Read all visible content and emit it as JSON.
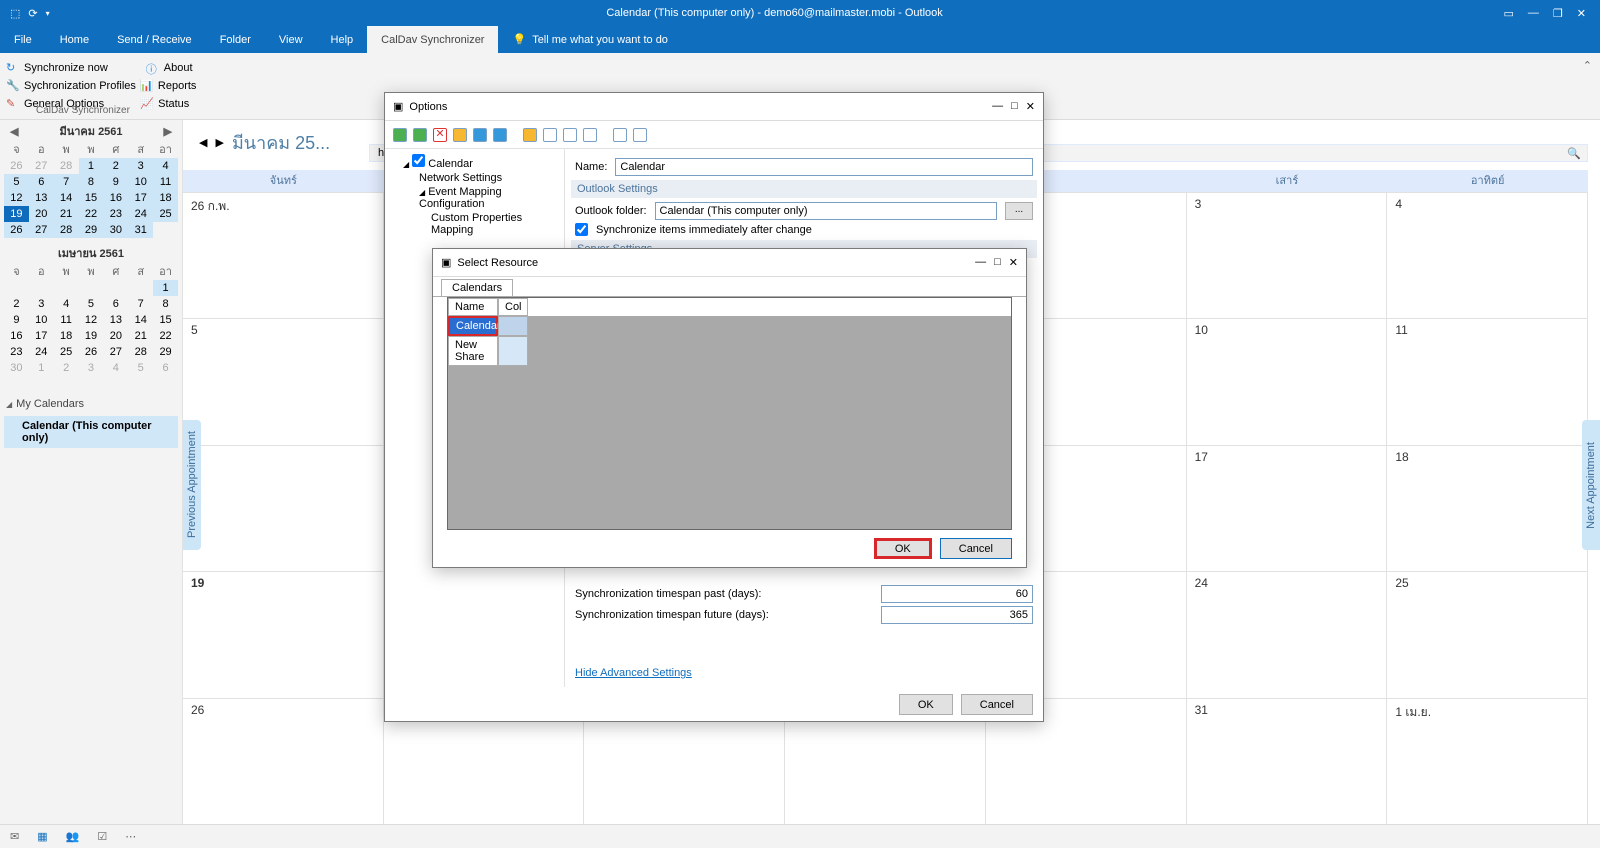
{
  "title": "Calendar (This computer only) - demo60@mailmaster.mobi - Outlook",
  "menus": {
    "file": "File",
    "home": "Home",
    "sendrecv": "Send / Receive",
    "folder": "Folder",
    "view": "View",
    "help": "Help",
    "caldav": "CalDav Synchronizer",
    "tell": "Tell me what you want to do"
  },
  "ribbon": {
    "sync_now": "Synchronize now",
    "about": "About",
    "profiles": "Sychronization Profiles",
    "reports": "Reports",
    "general": "General Options",
    "status": "Status",
    "group": "CalDav Synchronizer"
  },
  "minimonth1": {
    "title": "มีนาคม 2561",
    "days": [
      "จ",
      "อ",
      "พ",
      "พ",
      "ศ",
      "ส",
      "อา"
    ],
    "cells": [
      [
        26,
        "dim"
      ],
      [
        27,
        "dim"
      ],
      [
        28,
        "dim"
      ],
      [
        1,
        "sel"
      ],
      [
        2,
        "sel"
      ],
      [
        3,
        "sel"
      ],
      [
        4,
        "sel"
      ],
      [
        5,
        "sel"
      ],
      [
        6,
        "sel"
      ],
      [
        7,
        "sel"
      ],
      [
        8,
        "sel"
      ],
      [
        9,
        "sel"
      ],
      [
        10,
        "sel"
      ],
      [
        11,
        "sel"
      ],
      [
        12,
        "sel"
      ],
      [
        13,
        "sel"
      ],
      [
        14,
        "sel"
      ],
      [
        15,
        "sel"
      ],
      [
        16,
        "sel"
      ],
      [
        17,
        "sel"
      ],
      [
        18,
        "sel"
      ],
      [
        19,
        "today"
      ],
      [
        20,
        "sel"
      ],
      [
        21,
        "sel"
      ],
      [
        22,
        "sel"
      ],
      [
        23,
        "sel"
      ],
      [
        24,
        "sel"
      ],
      [
        25,
        "sel"
      ],
      [
        26,
        "sel"
      ],
      [
        27,
        "sel"
      ],
      [
        28,
        "sel"
      ],
      [
        29,
        "sel"
      ],
      [
        30,
        "sel"
      ],
      [
        31,
        "sel"
      ]
    ]
  },
  "minimonth2": {
    "title": "เมษายน 2561",
    "cells": [
      [
        "",
        "",
        ""
      ],
      [
        "",
        "",
        ""
      ],
      [
        "",
        "",
        ""
      ],
      [
        "",
        "",
        ""
      ],
      [
        "",
        "",
        ""
      ],
      [
        "",
        "",
        ""
      ],
      [
        1,
        "sel"
      ],
      [
        2,
        ""
      ],
      [
        3,
        ""
      ],
      [
        4,
        ""
      ],
      [
        5,
        ""
      ],
      [
        6,
        ""
      ],
      [
        7,
        ""
      ],
      [
        8,
        ""
      ],
      [
        9,
        ""
      ],
      [
        10,
        ""
      ],
      [
        11,
        ""
      ],
      [
        12,
        ""
      ],
      [
        13,
        ""
      ],
      [
        14,
        ""
      ],
      [
        15,
        ""
      ],
      [
        16,
        ""
      ],
      [
        17,
        ""
      ],
      [
        18,
        ""
      ],
      [
        19,
        ""
      ],
      [
        20,
        ""
      ],
      [
        21,
        ""
      ],
      [
        22,
        ""
      ],
      [
        23,
        ""
      ],
      [
        24,
        ""
      ],
      [
        25,
        ""
      ],
      [
        26,
        ""
      ],
      [
        27,
        ""
      ],
      [
        28,
        ""
      ],
      [
        29,
        ""
      ],
      [
        30,
        "dim"
      ],
      [
        1,
        "dim"
      ],
      [
        2,
        "dim"
      ],
      [
        3,
        "dim"
      ],
      [
        4,
        "dim"
      ],
      [
        5,
        "dim"
      ],
      [
        6,
        "dim"
      ]
    ]
  },
  "mycal": {
    "header": "My Calendars",
    "item": "Calendar (This computer only)"
  },
  "calheader": {
    "month": "มีนาคม 25...",
    "subtitle": "his computer only)"
  },
  "dayheads": [
    "จันทร์",
    "",
    "",
    "",
    "",
    "เสาร์",
    "อาทิตย์"
  ],
  "grid": [
    [
      "26 ก.พ.",
      "",
      "",
      "",
      "",
      "3",
      "4"
    ],
    [
      "5",
      "",
      "",
      "",
      "",
      "10",
      "11"
    ],
    [
      "",
      "",
      "",
      "",
      "",
      "17",
      "18"
    ],
    [
      "19",
      "",
      "",
      "",
      "",
      "24",
      "25"
    ],
    [
      "26",
      "",
      "",
      "",
      "",
      "31",
      "1 เม.ย."
    ]
  ],
  "prev_appt": "Previous Appointment",
  "next_appt": "Next Appointment",
  "options": {
    "title": "Options",
    "tree": {
      "root": "Calendar",
      "t1": "Network Settings",
      "t2": "Event Mapping Configuration",
      "t3": "Custom Properties Mapping"
    },
    "name_l": "Name:",
    "name_v": "Calendar",
    "out_sec": "Outlook Settings",
    "out_folder_l": "Outlook folder:",
    "out_folder_v": "Calendar (This computer only)",
    "sync_chk": "Synchronize items immediately after change",
    "srv_sec": "Server Settings",
    "past_l": "Synchronization timespan past (days):",
    "past_v": "60",
    "fut_l": "Synchronization timespan future (days):",
    "fut_v": "365",
    "hide": "Hide Advanced Settings",
    "ok": "OK",
    "cancel": "Cancel"
  },
  "resource": {
    "title": "Select Resource",
    "tab": "Calendars",
    "h1": "Name",
    "h2": "Col",
    "r1": "Calendar",
    "r2": "New Share",
    "ok": "OK",
    "cancel": "Cancel"
  }
}
